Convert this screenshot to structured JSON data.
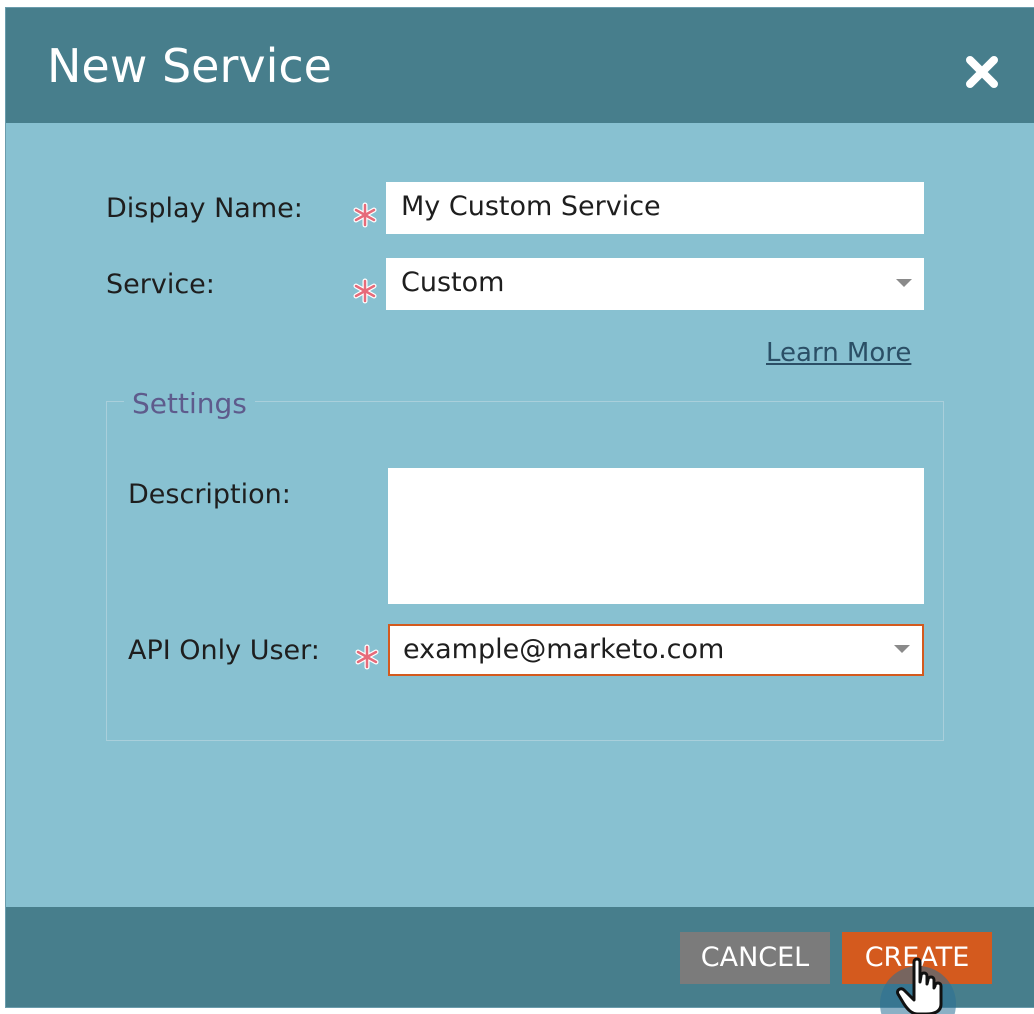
{
  "dialog": {
    "title": "New Service",
    "close_icon": "close-icon",
    "display_name": {
      "label": "Display Name:",
      "value": "My Custom Service"
    },
    "service": {
      "label": "Service:",
      "selected": "Custom"
    },
    "learn_more_label": "Learn More",
    "settings": {
      "legend": "Settings",
      "description": {
        "label": "Description:",
        "value": ""
      },
      "api_only_user": {
        "label": "API Only User:",
        "selected": "example@marketo.com"
      }
    },
    "footer": {
      "cancel_label": "CANCEL",
      "create_label": "CREATE"
    }
  },
  "colors": {
    "header": "#477e8c",
    "body": "#88c1d1",
    "create_button": "#d45a1e",
    "cancel_button": "#7b7b7b",
    "required_asterisk": "#e66b7a",
    "focused_border": "#d45a1e"
  }
}
